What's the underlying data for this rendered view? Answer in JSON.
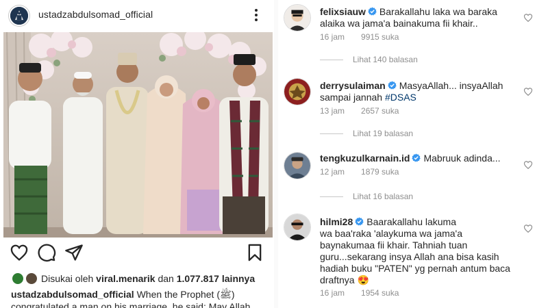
{
  "post": {
    "username": "ustadzabdulsomad_official",
    "liked_by_prefix": "Disukai oleh",
    "liked_by_user": "viral.menarik",
    "liked_by_and": "dan",
    "likes_count": "1.077.817",
    "likes_suffix": "lainnya",
    "caption_user": "ustadzabdulsomad_official",
    "caption_text": "When the Prophet (ﷺ) congratulated a man on his marriage, he said: May Allah"
  },
  "comments": [
    {
      "username": "felixsiauw",
      "text": "Barakallahu laka wa baraka alaika wa jama'a bainakuma fii khair..",
      "time": "16 jam",
      "likes": "9915 suka",
      "replies": "Lihat 140 balasan"
    },
    {
      "username": "derrysulaiman",
      "text_before_tag": "MasyaAllah... insyaAllah sampai jannah ",
      "hashtag": "#DSAS",
      "time": "13 jam",
      "likes": "2657 suka",
      "replies": "Lihat 19 balasan"
    },
    {
      "username": "tengkuzulkarnain.id",
      "text": "Mabruuk adinda...",
      "time": "12 jam",
      "likes": "1879 suka",
      "replies": "Lihat 16 balasan"
    },
    {
      "username": "hilmi28",
      "text_line1": "Baarakallahu lakuma",
      "text_rest": "wa baa'raka 'alaykuma wa jama'a baynakumaa fii khair. Tahniah tuan guru...sekarang insya Allah ana bisa kasih hadiah buku \"PATEN\" yg pernah antum baca draftnya 😍",
      "time": "16 jam",
      "likes": "1954 suka"
    }
  ],
  "icons": {
    "like": "heart-outline-icon",
    "comment": "comment-bubble-icon",
    "share": "paper-plane-icon",
    "save": "bookmark-icon",
    "more": "more-options-icon",
    "verified": "verified-badge-icon"
  },
  "colors": {
    "verified": "#3897f0",
    "text": "#262626",
    "muted": "#8e8e8e",
    "hashtag": "#00376b"
  }
}
